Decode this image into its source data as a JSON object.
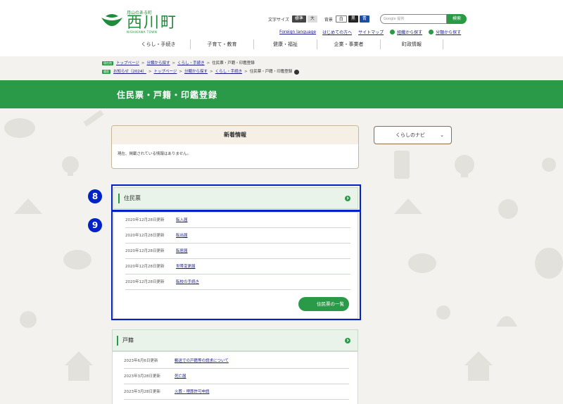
{
  "site": {
    "logo_sub": "月山のある町",
    "logo_main": "西川町",
    "logo_en": "NISHIKAWA TOWN"
  },
  "tools": {
    "font_size_label": "文字サイズ",
    "font_std": "標準",
    "font_large": "大",
    "bg_label": "背景",
    "bg_white": "白",
    "bg_black": "黒",
    "bg_blue": "青",
    "search_placeholder": "Google 提供",
    "search_button": "検索"
  },
  "sublinks": [
    "Foreign language",
    "はじめての方へ",
    "サイトマップ",
    "組織から探す",
    "分類から探す"
  ],
  "gnav": [
    "くらし・手続き",
    "子育て・教育",
    "健康・福祉",
    "企業・事業者",
    "町政情報"
  ],
  "breadcrumbs": {
    "row1": {
      "tag": "現在地",
      "links": [
        "トップページ",
        "分類から探す",
        "くらし・手続き"
      ],
      "current": "住民票・戸籍・印鑑登録"
    },
    "row2": {
      "tag": "履歴",
      "links": [
        "お知らせ（2024）",
        "トップページ",
        "分類から探す",
        "くらし・手続き"
      ],
      "current": "住民票・戸籍・印鑑登録"
    }
  },
  "page_title": "住民票・戸籍・印鑑登録",
  "news": {
    "title": "新着情報",
    "body": "現在、掲載されている情報はありません。"
  },
  "navi_button": "くらしのナビ",
  "sections": [
    {
      "title": "住民票",
      "items": [
        {
          "date": "2020年12月28日更新",
          "link": "転入届"
        },
        {
          "date": "2020年12月28日更新",
          "link": "転出届"
        },
        {
          "date": "2020年12月28日更新",
          "link": "転居届"
        },
        {
          "date": "2020年12月28日更新",
          "link": "世帯変更届"
        },
        {
          "date": "2020年12月28日更新",
          "link": "転校の手続き"
        }
      ],
      "more": "住民票の一覧"
    },
    {
      "title": "戸籍",
      "items": [
        {
          "date": "2023年6月6日更新",
          "link": "郵送での戸籍等の請求について"
        },
        {
          "date": "2023年3月28日更新",
          "link": "死亡届"
        },
        {
          "date": "2023年3月28日更新",
          "link": "火葬・埋葬許可申請"
        }
      ]
    }
  ],
  "annotations": [
    "8",
    "9"
  ],
  "colors": {
    "brand_green": "#2a9a48",
    "highlight_blue": "#0022c8"
  }
}
